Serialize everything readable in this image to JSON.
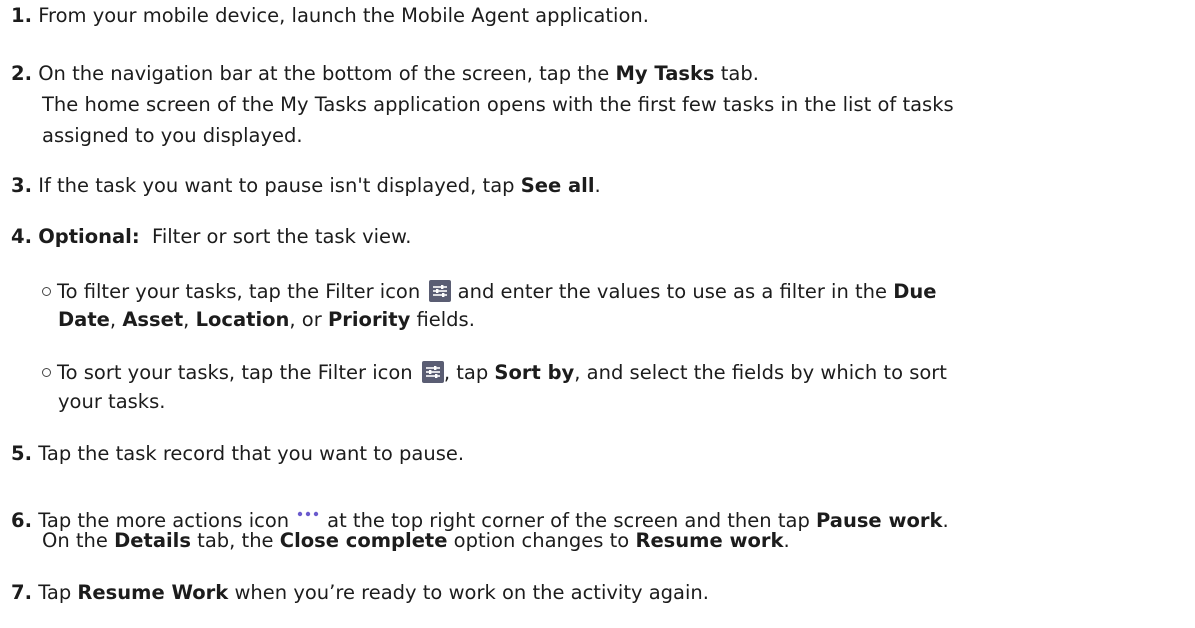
{
  "steps": {
    "s1": {
      "num": "1.",
      "text": "From your mobile device, launch the Mobile Agent application."
    },
    "s2": {
      "num": "2.",
      "pre": "On the navigation bar at the bottom of the screen, tap the ",
      "bold": "My Tasks",
      "post": " tab.",
      "result1": "The home screen of the My Tasks application opens with the first few tasks in the list of tasks",
      "result2": "assigned to you displayed."
    },
    "s3": {
      "num": "3.",
      "pre": "If the task you want to pause isn't displayed, tap ",
      "bold": "See all",
      "post": "."
    },
    "s4": {
      "num": "4.",
      "bold": "Optional:",
      "post": "  Filter or sort the task view.",
      "b1": {
        "pre": "To filter your tasks, tap the Filter icon ",
        "mid": " and enter the values to use as a filter in the ",
        "due": "Due",
        "date": "Date",
        "c1": ", ",
        "asset": "Asset",
        "c2": ", ",
        "location": "Location",
        "c3": ", or ",
        "priority": "Priority",
        "end": " fields."
      },
      "b2": {
        "pre": "To sort your tasks, tap the Filter icon ",
        "mid": ", tap ",
        "sortby": "Sort by",
        "post": ", and select the fields by which to sort",
        "line2": "your tasks."
      }
    },
    "s5": {
      "num": "5.",
      "text": "Tap the task record that you want to pause."
    },
    "s6": {
      "num": "6.",
      "pre": "Tap the more actions icon",
      "mid": "at the top right corner of the screen and then tap ",
      "pause": "Pause work",
      "end": ".",
      "r_pre": "On the ",
      "details": "Details",
      "r_mid": " tab, the ",
      "close": "Close complete",
      "r_mid2": " option changes to ",
      "resume": "Resume work",
      "r_end": "."
    },
    "s7": {
      "num": "7.",
      "pre": "Tap ",
      "bold": "Resume Work",
      "post": " when you’re ready to work on the activity again."
    }
  },
  "icons": {
    "filter": "filter-sliders-icon",
    "more": "more-actions-icon"
  },
  "colors": {
    "text": "#1c1c1c",
    "filter_icon_bg": "#5a5d73",
    "more_icon": "#6a5acd"
  }
}
